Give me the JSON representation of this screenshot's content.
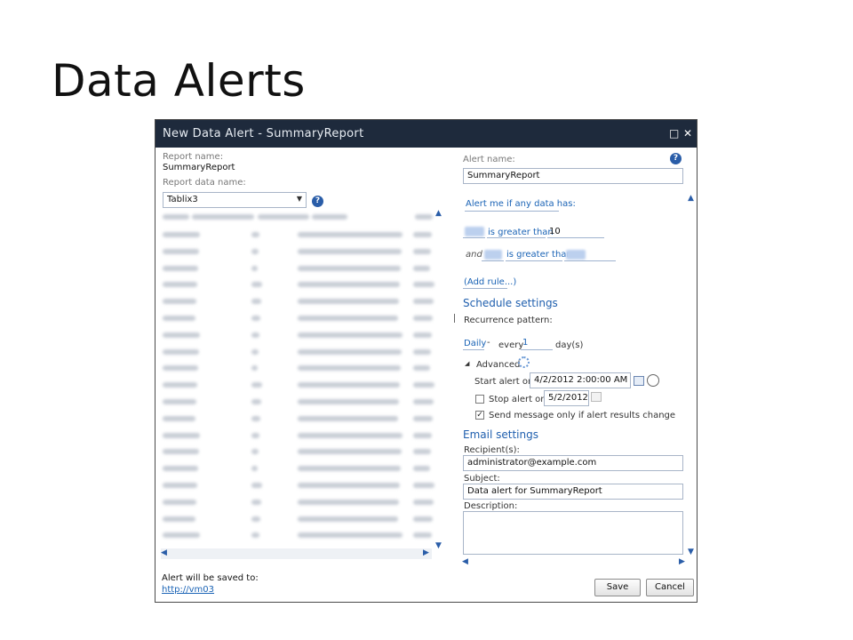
{
  "slide": {
    "title": "Data Alerts"
  },
  "dialog": {
    "title": "New Data Alert - SummaryReport",
    "maximize_glyph": "□",
    "close_glyph": "✕"
  },
  "left": {
    "report_name_label": "Report name:",
    "report_name": "SummaryReport",
    "report_data_label": "Report data name:",
    "report_data_value": "Tablix3",
    "help": "?",
    "saved_label": "Alert will be saved to:",
    "saved_link": "http://vm03"
  },
  "right": {
    "alert_name_label": "Alert name:",
    "alert_name": "SummaryReport",
    "alert_me_link": "Alert me if any data has:",
    "rule1_op": "is greater than",
    "rule1_value": "10",
    "rule2_and": "and",
    "rule2_op": "is greater than",
    "add_rule": "(Add rule...)",
    "schedule_heading": "Schedule settings",
    "recurrence_label": "Recurrence pattern:",
    "recurrence_value": "Daily",
    "recurrence_dash": "-",
    "every_label": "every",
    "every_value": "1",
    "days_label": "day(s)",
    "advanced_label": "Advanced",
    "start_label": "Start alert on:",
    "start_value": "4/2/2012 2:00:00 AM",
    "stop_label": "Stop alert on:",
    "stop_value": "5/2/2012",
    "send_label": "Send message only if alert results change",
    "email_heading": "Email settings",
    "recipients_label": "Recipient(s):",
    "recipients_value": "administrator@example.com",
    "subject_label": "Subject:",
    "subject_value": "Data alert for SummaryReport",
    "description_label": "Description:"
  },
  "buttons": {
    "save": "Save",
    "cancel": "Cancel"
  }
}
